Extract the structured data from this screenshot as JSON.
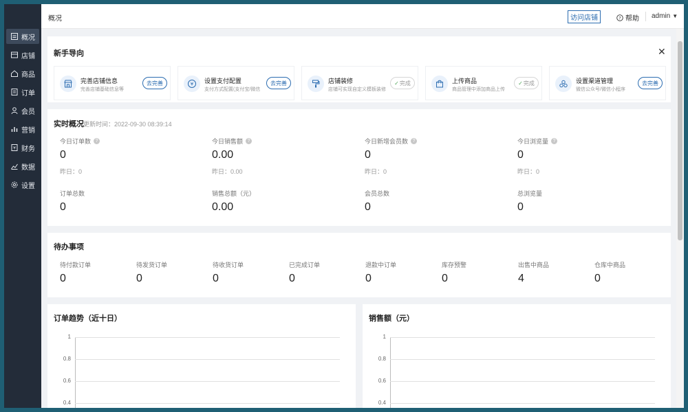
{
  "sidebar": {
    "items": [
      {
        "label": "概况",
        "icon": "overview-icon",
        "active": true
      },
      {
        "label": "店铺",
        "icon": "store-icon"
      },
      {
        "label": "商品",
        "icon": "goods-icon"
      },
      {
        "label": "订单",
        "icon": "order-icon"
      },
      {
        "label": "会员",
        "icon": "member-icon"
      },
      {
        "label": "营销",
        "icon": "marketing-icon"
      },
      {
        "label": "财务",
        "icon": "finance-icon"
      },
      {
        "label": "数据",
        "icon": "data-icon"
      },
      {
        "label": "设置",
        "icon": "settings-icon"
      }
    ]
  },
  "header": {
    "breadcrumb": "概况",
    "visit_store": "访问店铺",
    "help": "帮助",
    "user": "admin"
  },
  "guide": {
    "title": "新手导向",
    "items": [
      {
        "title": "完善店铺信息",
        "desc": "完善店铺基础信息等",
        "button": "去完善",
        "done": false,
        "icon": "store-icon"
      },
      {
        "title": "设置支付配置",
        "desc": "支付方式配置(支付宝/微信",
        "button": "去完善",
        "done": false,
        "icon": "yen-icon"
      },
      {
        "title": "店铺装修",
        "desc": "店铺可实现自定义模板装修",
        "button": "完成",
        "done": true,
        "icon": "paint-roller-icon"
      },
      {
        "title": "上传商品",
        "desc": "商品管理中添加商品上传",
        "button": "完成",
        "done": true,
        "icon": "shopping-bag-icon"
      },
      {
        "title": "设置渠道管理",
        "desc": "微信公众号/微信小程序",
        "button": "去完善",
        "done": false,
        "icon": "channel-icon"
      }
    ]
  },
  "realtime": {
    "title": "实时概况",
    "updated": "更新时间：2022-09-30 08:39:14",
    "today": [
      {
        "label": "今日订单数",
        "value": "0",
        "yesterday": "昨日：0"
      },
      {
        "label": "今日销售额",
        "value": "0.00",
        "yesterday": "昨日：0.00"
      },
      {
        "label": "今日新增会员数",
        "value": "0",
        "yesterday": "昨日：0"
      },
      {
        "label": "今日浏览量",
        "value": "0",
        "yesterday": "昨日：0"
      }
    ],
    "totals": [
      {
        "label": "订单总数",
        "value": "0"
      },
      {
        "label": "销售总额（元）",
        "value": "0.00"
      },
      {
        "label": "会员总数",
        "value": "0"
      },
      {
        "label": "总浏览量",
        "value": "0"
      }
    ]
  },
  "todo": {
    "title": "待办事项",
    "items": [
      {
        "label": "待付款订单",
        "value": "0"
      },
      {
        "label": "待发货订单",
        "value": "0"
      },
      {
        "label": "待收货订单",
        "value": "0"
      },
      {
        "label": "已完成订单",
        "value": "0"
      },
      {
        "label": "退款中订单",
        "value": "0"
      },
      {
        "label": "库存预警",
        "value": "0"
      },
      {
        "label": "出售中商品",
        "value": "4"
      },
      {
        "label": "仓库中商品",
        "value": "0"
      }
    ]
  },
  "chart_data": [
    {
      "type": "line",
      "title": "订单趋势（近十日）",
      "y_ticks": [
        "1",
        "0.8",
        "0.6",
        "0.4"
      ],
      "ylim": [
        0,
        1
      ],
      "grid": true
    },
    {
      "type": "line",
      "title": "销售额（元）",
      "y_ticks": [
        "1",
        "0.8",
        "0.6",
        "0.4"
      ],
      "ylim": [
        0,
        1
      ],
      "grid": true
    }
  ]
}
